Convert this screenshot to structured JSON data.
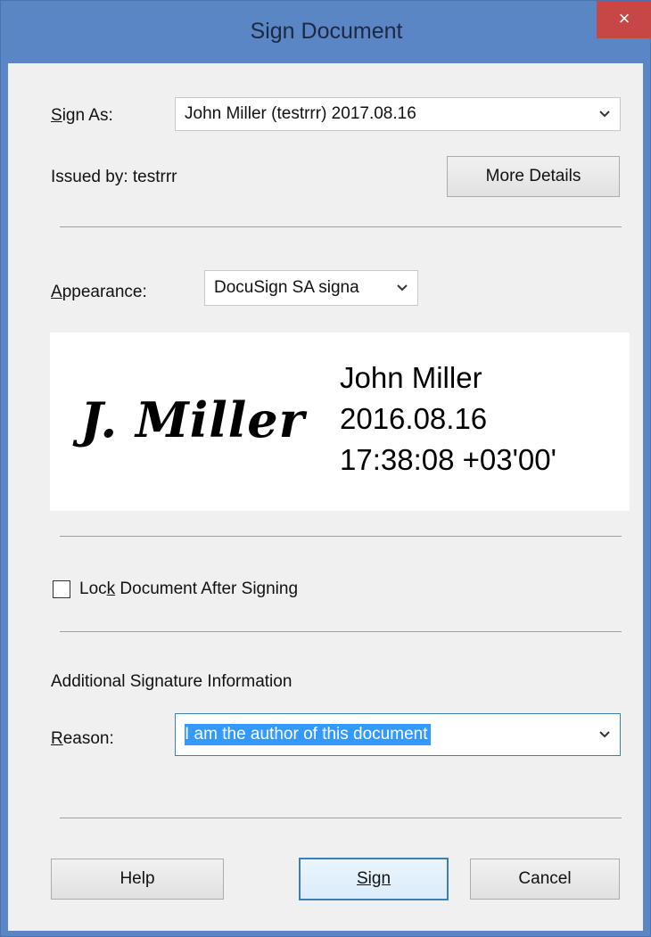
{
  "window": {
    "title": "Sign Document",
    "close_glyph": "×"
  },
  "sign_as": {
    "label": "Sign As:",
    "value": "John Miller (testrrr) 2017.08.16"
  },
  "issued_by": "Issued by: testrrr",
  "more_details_label": "More Details",
  "appearance": {
    "label": "Appearance:",
    "value": "DocuSign SA signa"
  },
  "signature_preview": {
    "script": "J. Miller",
    "name": "John Miller",
    "date": "2016.08.16",
    "time": "17:38:08 +03'00'"
  },
  "lock_document": {
    "label": "Lock Document After Signing",
    "checked": false
  },
  "additional_info": {
    "heading": "Additional Signature Information",
    "reason_label": "Reason:",
    "reason_value": "I am the author of this document"
  },
  "buttons": {
    "help": "Help",
    "sign": "Sign",
    "cancel": "Cancel"
  },
  "colors": {
    "title_bar": "#5a86c6",
    "close_button": "#c74646",
    "selection": "#3399ff",
    "dialog_bg": "#f0f0f0"
  }
}
